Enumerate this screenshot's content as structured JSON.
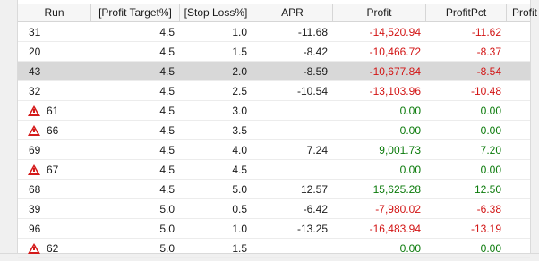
{
  "columns": [
    "Run",
    "[Profit Target%]",
    "[Stop Loss%]",
    "APR",
    "Profit",
    "ProfitPct",
    "Profit"
  ],
  "rows": [
    {
      "run": "31",
      "warn": false,
      "pt": "4.5",
      "sl": "1.0",
      "apr": "-11.68",
      "profit": "-14,520.94",
      "pct": "-11.62"
    },
    {
      "run": "20",
      "warn": false,
      "pt": "4.5",
      "sl": "1.5",
      "apr": "-8.42",
      "profit": "-10,466.72",
      "pct": "-8.37"
    },
    {
      "run": "43",
      "warn": false,
      "pt": "4.5",
      "sl": "2.0",
      "apr": "-8.59",
      "profit": "-10,677.84",
      "pct": "-8.54",
      "selected": true
    },
    {
      "run": "32",
      "warn": false,
      "pt": "4.5",
      "sl": "2.5",
      "apr": "-10.54",
      "profit": "-13,103.96",
      "pct": "-10.48"
    },
    {
      "run": "61",
      "warn": true,
      "pt": "4.5",
      "sl": "3.0",
      "apr": "",
      "profit": "0.00",
      "pct": "0.00"
    },
    {
      "run": "66",
      "warn": true,
      "pt": "4.5",
      "sl": "3.5",
      "apr": "",
      "profit": "0.00",
      "pct": "0.00"
    },
    {
      "run": "69",
      "warn": false,
      "pt": "4.5",
      "sl": "4.0",
      "apr": "7.24",
      "profit": "9,001.73",
      "pct": "7.20"
    },
    {
      "run": "67",
      "warn": true,
      "pt": "4.5",
      "sl": "4.5",
      "apr": "",
      "profit": "0.00",
      "pct": "0.00"
    },
    {
      "run": "68",
      "warn": false,
      "pt": "4.5",
      "sl": "5.0",
      "apr": "12.57",
      "profit": "15,625.28",
      "pct": "12.50"
    },
    {
      "run": "39",
      "warn": false,
      "pt": "5.0",
      "sl": "0.5",
      "apr": "-6.42",
      "profit": "-7,980.02",
      "pct": "-6.38"
    },
    {
      "run": "96",
      "warn": false,
      "pt": "5.0",
      "sl": "1.0",
      "apr": "-13.25",
      "profit": "-16,483.94",
      "pct": "-13.19"
    },
    {
      "run": "62",
      "warn": true,
      "pt": "5.0",
      "sl": "1.5",
      "apr": "",
      "profit": "0.00",
      "pct": "0.00"
    }
  ],
  "colors": {
    "negative": "#d21414",
    "positive": "#0a7a0a",
    "selected_row": "#d8d8d8",
    "warning": "#d41a1a"
  },
  "icons": {
    "warning": "warning-triangle-icon"
  }
}
